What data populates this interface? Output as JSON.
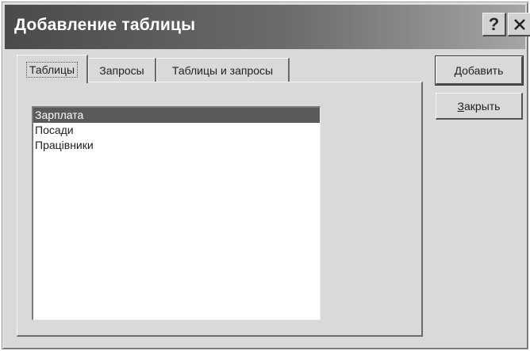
{
  "window": {
    "title": "Добавление таблицы"
  },
  "titlebar": {
    "help_label": "?"
  },
  "tabs": [
    {
      "label": "Таблицы"
    },
    {
      "label": "Запросы"
    },
    {
      "label": "Таблицы и запросы"
    }
  ],
  "table_list": {
    "items": [
      {
        "label": "Зарплата"
      },
      {
        "label": "Посади"
      },
      {
        "label": "Працівники"
      }
    ]
  },
  "buttons": {
    "add": {
      "first": "Д",
      "rest": "обавить"
    },
    "close": {
      "first": "З",
      "rest": "акрыть"
    }
  },
  "icons": {
    "help": "help-icon",
    "close": "close-icon"
  }
}
